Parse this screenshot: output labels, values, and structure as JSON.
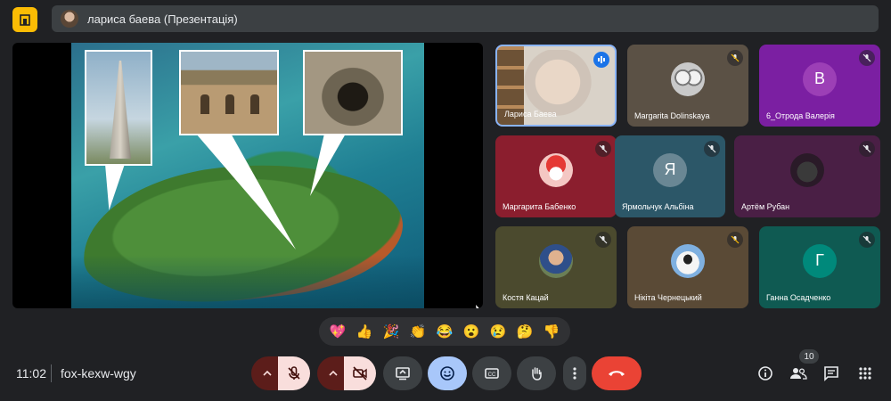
{
  "topbar": {
    "presenter_title": "лариса баева (Презентація)"
  },
  "participants": [
    {
      "name": "Лариса Баева",
      "state": "speaking",
      "bg": "#d9d2c8"
    },
    {
      "name": "Margarita Dolinskaya",
      "state": "muted",
      "bg": "#5b5145",
      "avatar": "cats"
    },
    {
      "name": "6_Отрода Валерія",
      "state": "muted",
      "bg": "#7b1fa2",
      "avatar_letter": "В",
      "avatar_bg": "#8e24aa"
    },
    {
      "name": "Маргарита Бабенко",
      "state": "muted",
      "bg": "#8b1e2e",
      "avatar": "santa"
    },
    {
      "name": "Ярмольчук Альбіна",
      "state": "muted",
      "bg": "#2c5768",
      "avatar_letter": "Я",
      "avatar_bg": "#5f7d8a"
    },
    {
      "name": "Артём Рубан",
      "state": "muted",
      "bg": "#4a1f45",
      "avatar": "cat"
    },
    {
      "name": "Костя Кацай",
      "state": "muted",
      "bg": "#4b4a2e",
      "avatar": "boy"
    },
    {
      "name": "Нікіта Чернецький",
      "state": "muted",
      "bg": "#5a4a36",
      "avatar": "cool-cat"
    },
    {
      "name": "Ганна Осадченко",
      "state": "muted",
      "bg": "#0f5a52",
      "avatar_letter": "Г",
      "avatar_bg": "#00796b"
    }
  ],
  "reactions": [
    "💖",
    "👍",
    "🎉",
    "👏",
    "😂",
    "😮",
    "😢",
    "🤔",
    "👎"
  ],
  "bottombar": {
    "time": "11:02",
    "meeting_code": "fox-kexw-wgy",
    "participant_count": "10"
  },
  "colors": {
    "background": "#202124",
    "accent_yellow": "#fbbc04",
    "end_call": "#ea4335",
    "active_blue": "#a8c7fa"
  }
}
